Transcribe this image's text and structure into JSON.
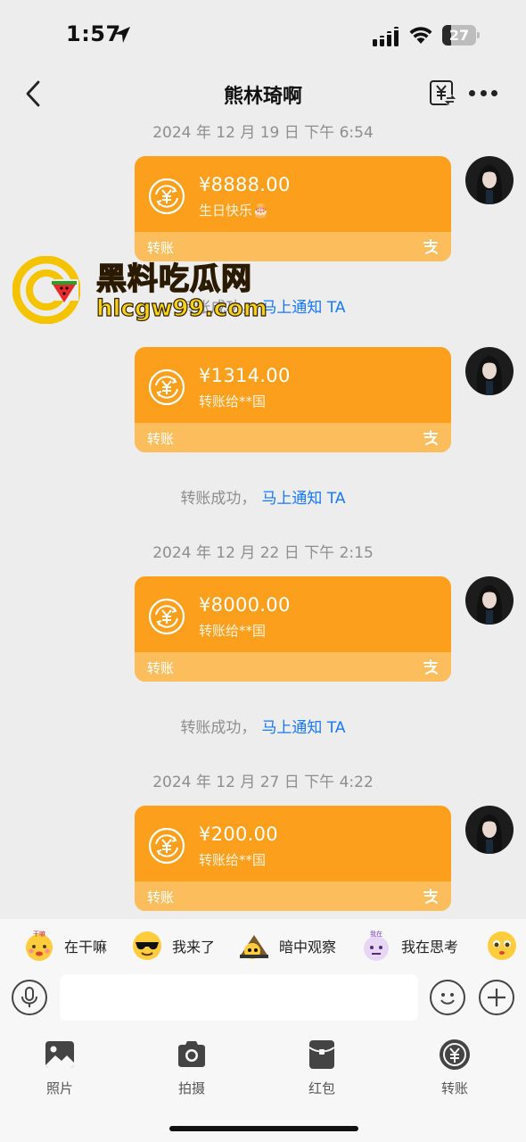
{
  "status_bar": {
    "time": "1:57",
    "battery": "27",
    "battery_level": 0.27
  },
  "header": {
    "title": "熊林琦啊"
  },
  "messages": [
    {
      "timestamp": "2024 年 12 月 19 日  下午 6:54",
      "amount": "¥8888.00",
      "memo": "生日快乐🎂",
      "footer_label": "转账"
    },
    {
      "notice_text": "转账成功，",
      "notice_link": "马上通知 TA",
      "amount": "¥1314.00",
      "memo": "转账给**国",
      "footer_label": "转账"
    },
    {
      "notice_text": "转账成功，",
      "notice_link": "马上通知 TA",
      "timestamp": "2024 年 12 月 22 日  下午 2:15",
      "amount": "¥8000.00",
      "memo": "转账给**国",
      "footer_label": "转账"
    },
    {
      "notice_text": "转账成功，",
      "notice_link": "马上通知 TA",
      "timestamp": "2024 年 12 月 27 日  下午 4:22",
      "amount": "¥200.00",
      "memo": "转账给**国",
      "footer_label": "转账"
    }
  ],
  "watermark": {
    "title": "黑料吃瓜网",
    "url": "hlcgw99.com"
  },
  "quick_replies": [
    {
      "label": "在干嘛",
      "icon": "busy-face-icon",
      "badge": "干嘛"
    },
    {
      "label": "我来了",
      "icon": "sunglasses-face-icon"
    },
    {
      "label": "暗中观察",
      "icon": "peeking-face-icon"
    },
    {
      "label": "我在思考",
      "icon": "thinking-face-icon",
      "badge": "我在"
    },
    {
      "label": "",
      "icon": "pleading-face-icon"
    }
  ],
  "toolbar": [
    {
      "label": "照片",
      "icon": "photo-icon"
    },
    {
      "label": "拍摄",
      "icon": "camera-icon"
    },
    {
      "label": "红包",
      "icon": "red-packet-icon"
    },
    {
      "label": "转账",
      "icon": "transfer-icon"
    }
  ],
  "colors": {
    "card": "#fb9f1c",
    "card_footer": "#fcbe5d",
    "link": "#1677ff",
    "background": "#ededed"
  }
}
